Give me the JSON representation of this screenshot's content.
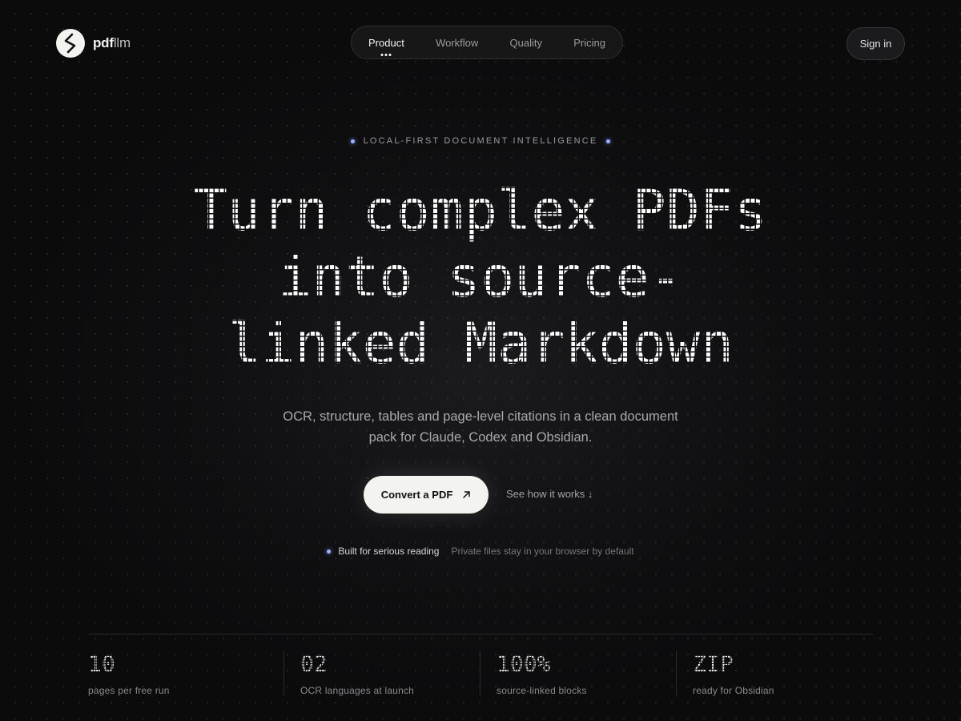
{
  "brand": {
    "name_bold": "pdf",
    "name_light": "llm"
  },
  "nav": {
    "items": [
      {
        "label": "Product",
        "active": true
      },
      {
        "label": "Workflow",
        "active": false
      },
      {
        "label": "Quality",
        "active": false
      },
      {
        "label": "Pricing",
        "active": false
      }
    ]
  },
  "header": {
    "signin_label": "Sign in"
  },
  "hero": {
    "eyebrow": "LOCAL-FIRST DOCUMENT INTELLIGENCE",
    "headline_lines": [
      "Turn complex PDFs",
      "into source-",
      "linked Markdown"
    ],
    "subtitle_lines": [
      "OCR, structure, tables and page-level citations in a clean document",
      "pack for Claude, Codex and Obsidian."
    ],
    "cta_label": "Convert a PDF",
    "cta_icon": "arrow-up-right-icon",
    "secondary_label": "See how it works ↓",
    "trust_strong": "Built for serious reading",
    "trust_muted": "Private files stay in your browser by default"
  },
  "stats": [
    {
      "value": "10",
      "label": "pages per free run"
    },
    {
      "value": "02",
      "label": "OCR languages at launch"
    },
    {
      "value": "100%",
      "label": "source-linked blocks"
    },
    {
      "value": "ZIP",
      "label": "ready for Obsidian"
    }
  ],
  "colors": {
    "background": "#0b0b0c",
    "accent_dot": "#9fb2ff",
    "cta_background": "#f3f3ef"
  }
}
